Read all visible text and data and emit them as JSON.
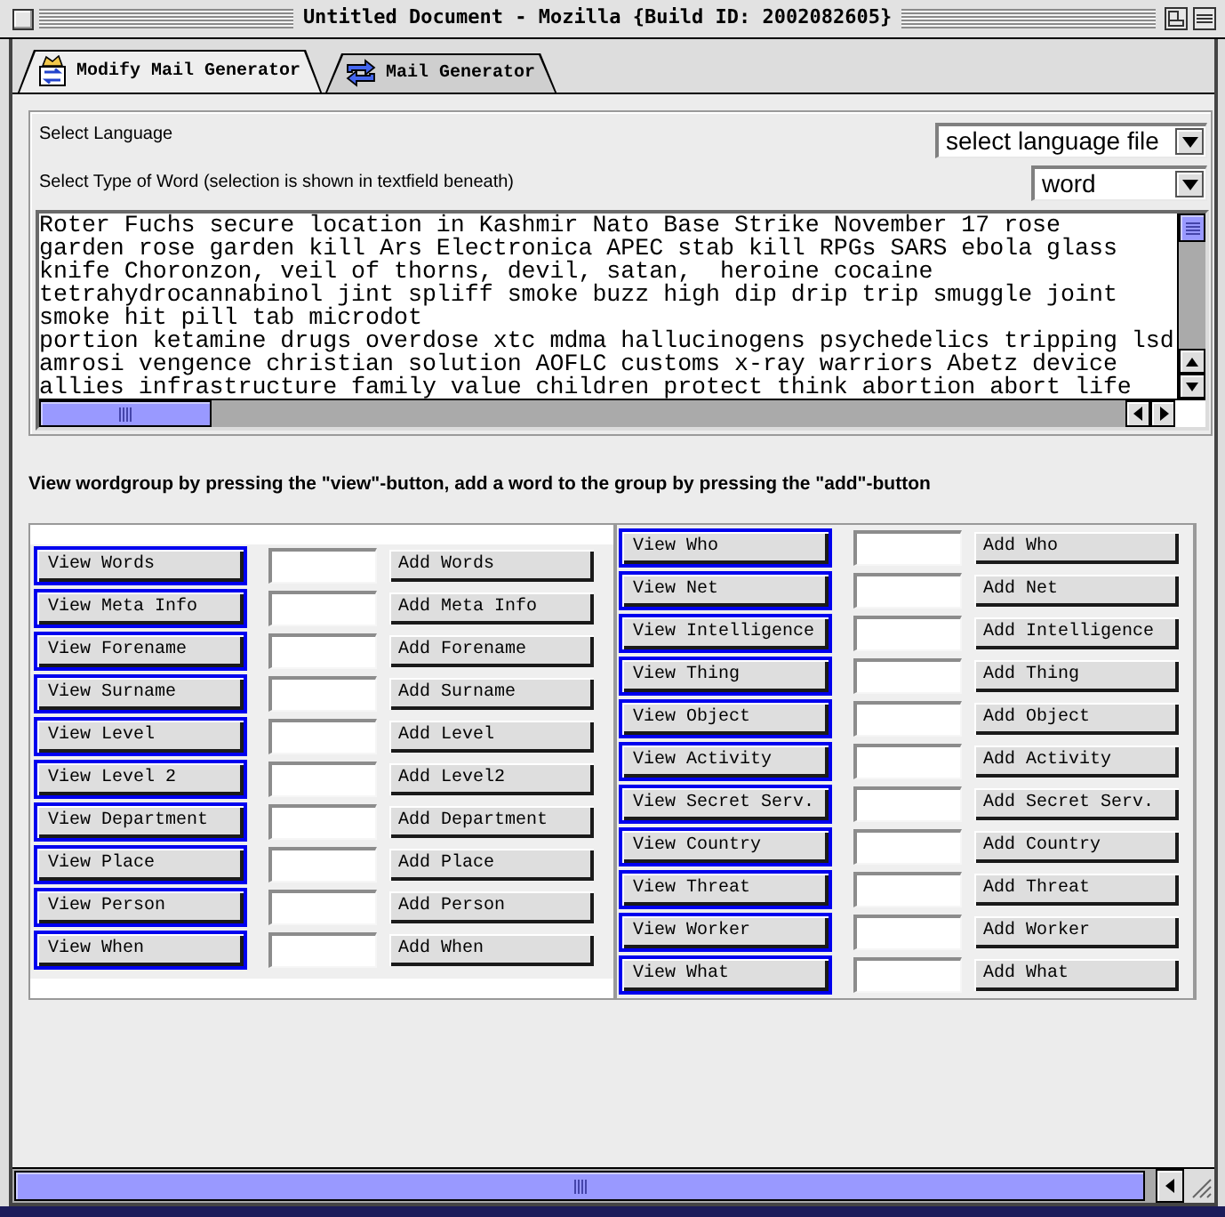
{
  "window": {
    "title": "Untitled Document - Mozilla {Build ID: 2002082605}"
  },
  "tabs": [
    {
      "label": "Modify Mail Generator",
      "selected": true
    },
    {
      "label": "Mail Generator",
      "selected": false
    }
  ],
  "language_select": {
    "label": "Select Language",
    "value": "select language file"
  },
  "word_type_select": {
    "label": "Select Type of Word (selection is shown in textfield beneath)",
    "value": "word"
  },
  "word_list": {
    "lines": [
      "Roter Fuchs secure location in Kashmir Nato Base Strike November 17 rose",
      "garden rose garden kill Ars Electronica APEC stab kill RPGs SARS ebola glass",
      "knife Choronzon, veil of thorns, devil, satan,  heroine cocaine",
      "tetrahydrocannabinol jint spliff smoke buzz high dip drip trip smuggle joint",
      "smoke hit pill tab microdot",
      "portion ketamine drugs overdose xtc mdma hallucinogens psychedelics tripping lsd",
      "amrosi vengence christian solution AOFLC customs x-ray warriors Abetz device",
      "allies infrastructure family value children protect think abortion abort life"
    ]
  },
  "instruction": "View wordgroup by pressing the \"view\"-button, add a word to the group by pressing the \"add\"-button",
  "word_groups": {
    "left": [
      {
        "view_button": "View Words",
        "add_button": "Add Words"
      },
      {
        "view_button": "View Meta Info",
        "add_button": "Add Meta Info"
      },
      {
        "view_button": "View Forename",
        "add_button": "Add Forename"
      },
      {
        "view_button": "View Surname",
        "add_button": "Add Surname"
      },
      {
        "view_button": "View Level",
        "add_button": "Add Level"
      },
      {
        "view_button": "View Level 2",
        "add_button": "Add Level2"
      },
      {
        "view_button": "View Department",
        "add_button": "Add Department"
      },
      {
        "view_button": "View Place",
        "add_button": "Add Place"
      },
      {
        "view_button": "View Person",
        "add_button": "Add Person"
      },
      {
        "view_button": "View When",
        "add_button": "Add When"
      }
    ],
    "right": [
      {
        "view_button": "View Who",
        "add_button": "Add Who"
      },
      {
        "view_button": "View Net",
        "add_button": "Add Net"
      },
      {
        "view_button": "View Intelligence",
        "add_button": "Add Intelligence"
      },
      {
        "view_button": "View Thing",
        "add_button": "Add Thing"
      },
      {
        "view_button": "View Object",
        "add_button": "Add Object"
      },
      {
        "view_button": "View Activity",
        "add_button": "Add Activity"
      },
      {
        "view_button": "View Secret Serv.",
        "add_button": "Add Secret Serv."
      },
      {
        "view_button": "View Country",
        "add_button": "Add Country"
      },
      {
        "view_button": "View Threat",
        "add_button": "Add Threat"
      },
      {
        "view_button": "View Worker",
        "add_button": "Add Worker"
      },
      {
        "view_button": "View What",
        "add_button": "Add What"
      }
    ]
  }
}
